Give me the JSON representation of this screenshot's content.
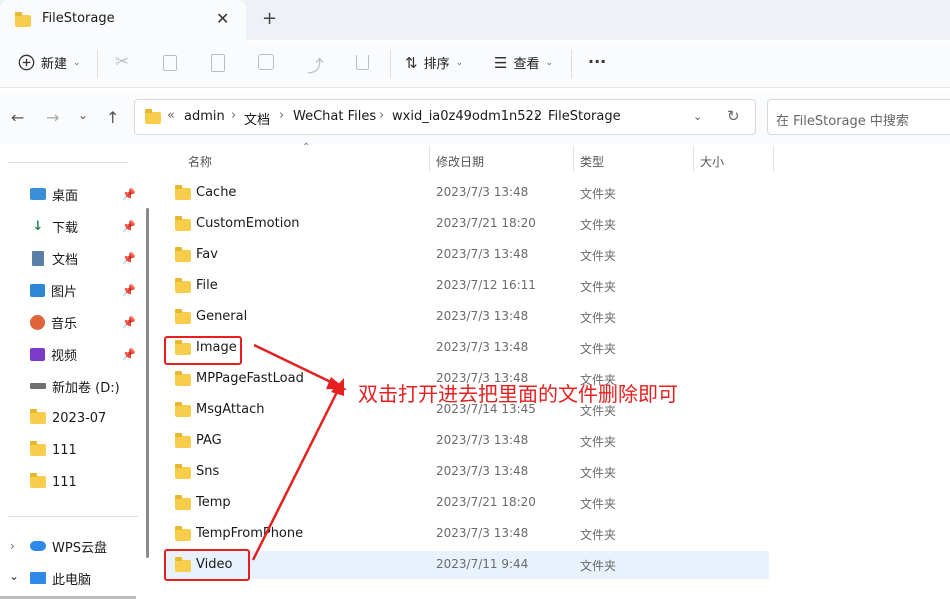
{
  "tab": {
    "title": "FileStorage",
    "close": "✕",
    "new_tab": "+"
  },
  "toolbar": {
    "new_label": "新建",
    "sort_label": "排序",
    "view_label": "查看",
    "more": "···"
  },
  "breadcrumbs": [
    "admin",
    "文档",
    "WeChat Files",
    "wxid_ia0z49odm1n522",
    "FileStorage"
  ],
  "search": {
    "placeholder": "在 FileStorage 中搜索"
  },
  "sidebar": {
    "items": [
      {
        "label": "桌面",
        "icon": "desktop-icon",
        "pinned": true
      },
      {
        "label": "下载",
        "icon": "download-icon",
        "pinned": true
      },
      {
        "label": "文档",
        "icon": "document-icon",
        "pinned": true
      },
      {
        "label": "图片",
        "icon": "picture-icon",
        "pinned": true
      },
      {
        "label": "音乐",
        "icon": "music-icon",
        "pinned": true
      },
      {
        "label": "视频",
        "icon": "video-icon",
        "pinned": true
      },
      {
        "label": "新加卷 (D:)",
        "icon": "drive-icon",
        "pinned": false
      },
      {
        "label": "2023-07",
        "icon": "folder-icon",
        "pinned": false
      },
      {
        "label": "111",
        "icon": "folder-icon",
        "pinned": false
      },
      {
        "label": "111",
        "icon": "folder-icon",
        "pinned": false
      }
    ],
    "bottom": [
      {
        "label": "WPS云盘",
        "icon": "cloud-icon"
      },
      {
        "label": "此电脑",
        "icon": "computer-icon"
      }
    ]
  },
  "columns": {
    "name": "名称",
    "date": "修改日期",
    "type": "类型",
    "size": "大小"
  },
  "files": [
    {
      "name": "Cache",
      "date": "2023/7/3 13:48",
      "type": "文件夹"
    },
    {
      "name": "CustomEmotion",
      "date": "2023/7/21 18:20",
      "type": "文件夹"
    },
    {
      "name": "Fav",
      "date": "2023/7/3 13:48",
      "type": "文件夹"
    },
    {
      "name": "File",
      "date": "2023/7/12 16:11",
      "type": "文件夹"
    },
    {
      "name": "General",
      "date": "2023/7/3 13:48",
      "type": "文件夹"
    },
    {
      "name": "Image",
      "date": "2023/7/3 13:48",
      "type": "文件夹"
    },
    {
      "name": "MPPageFastLoad",
      "date": "2023/7/3 13:48",
      "type": "文件夹"
    },
    {
      "name": "MsgAttach",
      "date": "2023/7/14 13:45",
      "type": "文件夹"
    },
    {
      "name": "PAG",
      "date": "2023/7/3 13:48",
      "type": "文件夹"
    },
    {
      "name": "Sns",
      "date": "2023/7/3 13:48",
      "type": "文件夹"
    },
    {
      "name": "Temp",
      "date": "2023/7/21 18:20",
      "type": "文件夹"
    },
    {
      "name": "TempFromPhone",
      "date": "2023/7/3 13:48",
      "type": "文件夹"
    },
    {
      "name": "Video",
      "date": "2023/7/11 9:44",
      "type": "文件夹"
    }
  ],
  "annotation": {
    "text": "双击打开进去把里面的文件删除即可",
    "color": "#e62020"
  },
  "colors": {
    "folder": "#f8cd4c",
    "selected_row": "#e8f2fc",
    "accent": "#0067c0"
  }
}
